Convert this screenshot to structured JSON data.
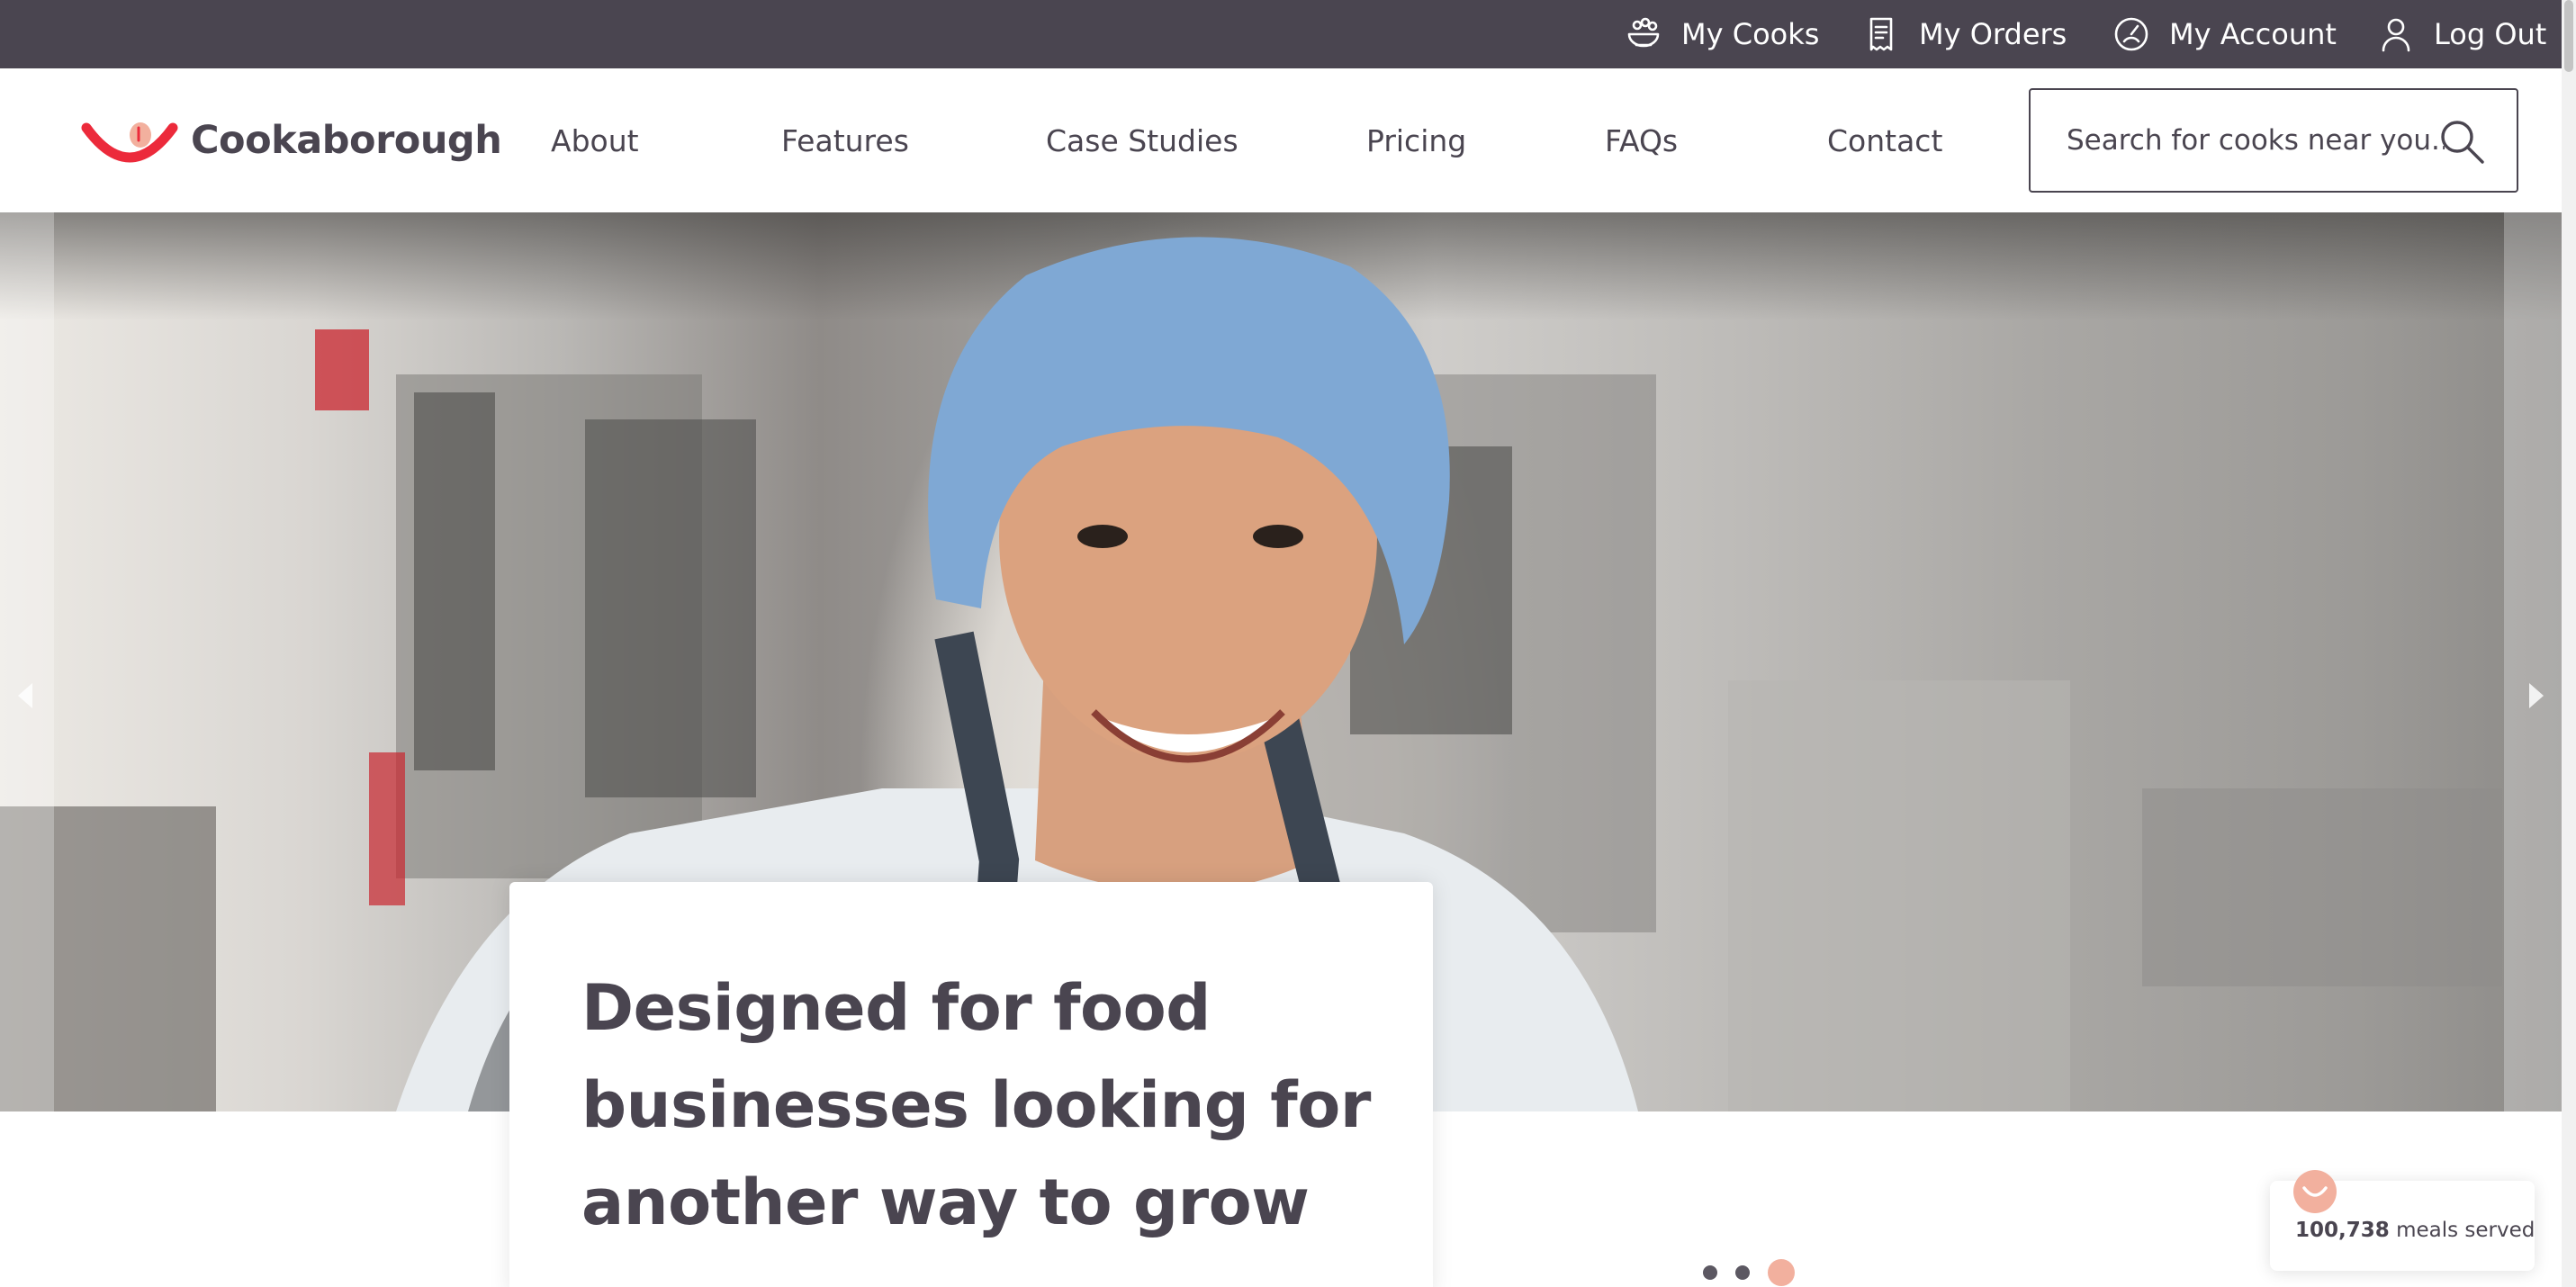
{
  "utility_nav": {
    "items": [
      {
        "label": "My Cooks",
        "icon": "cook-bowl-icon"
      },
      {
        "label": "My Orders",
        "icon": "receipt-icon"
      },
      {
        "label": "My Account",
        "icon": "account-gauge-icon"
      },
      {
        "label": "Log Out",
        "icon": "user-icon"
      }
    ]
  },
  "header": {
    "logo_text": "Cookaborough",
    "nav": [
      "About",
      "Features",
      "Case Studies",
      "Pricing",
      "FAQs",
      "Contact"
    ],
    "search": {
      "placeholder": "Search for cooks near you...",
      "value": ""
    }
  },
  "hero": {
    "image": "chef-in-hairnet-kitchen-photo",
    "headline_lines": [
      "Designed for food",
      "businesses looking for",
      "another way to grow"
    ],
    "slider": {
      "count": 3,
      "active_index": 2
    }
  },
  "meals_widget": {
    "count": "100,738",
    "label": "meals served"
  },
  "colors": {
    "utility_bar": "#4a4550",
    "text": "#4a4550",
    "brand_red": "#ec2a3b",
    "accent_peach": "#f2b09e"
  }
}
